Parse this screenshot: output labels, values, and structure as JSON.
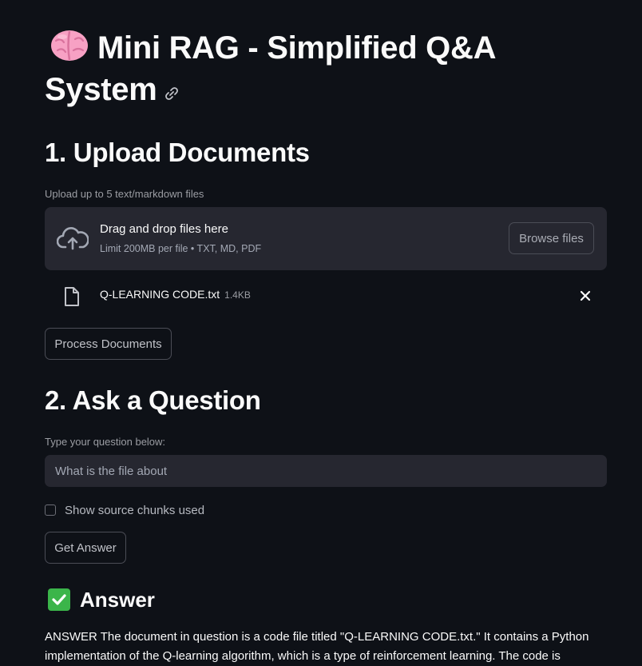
{
  "page": {
    "title": "Mini RAG - Simplified Q&A System"
  },
  "upload": {
    "heading": "1. Upload Documents",
    "label": "Upload up to 5 text/markdown files",
    "drop_title": "Drag and drop files here",
    "drop_limit": "Limit 200MB per file • TXT, MD, PDF",
    "browse_label": "Browse files",
    "files": [
      {
        "name": "Q-LEARNING CODE.txt",
        "size": "1.4KB"
      }
    ],
    "process_label": "Process Documents"
  },
  "question": {
    "heading": "2. Ask a Question",
    "label": "Type your question below:",
    "value": "What is the file about",
    "show_chunks_label": "Show source chunks used",
    "show_chunks_checked": false,
    "submit_label": "Get Answer"
  },
  "answer": {
    "heading": "Answer",
    "text": "ANSWER The document in question is a code file titled \"Q-LEARNING CODE.txt.\" It contains a Python implementation of the Q-learning algorithm, which is a type of reinforcement learning. The code is"
  },
  "icons": {
    "title": "brain-icon",
    "anchor": "link-icon",
    "upload": "cloud-upload-icon",
    "file": "file-icon",
    "remove": "close-icon",
    "answer": "check-icon"
  },
  "colors": {
    "background": "#0e1117",
    "surface": "#262730",
    "text": "#fafafa",
    "muted": "#9b9da3",
    "brain": "#f7a1c4",
    "check": "#3bb54a"
  }
}
